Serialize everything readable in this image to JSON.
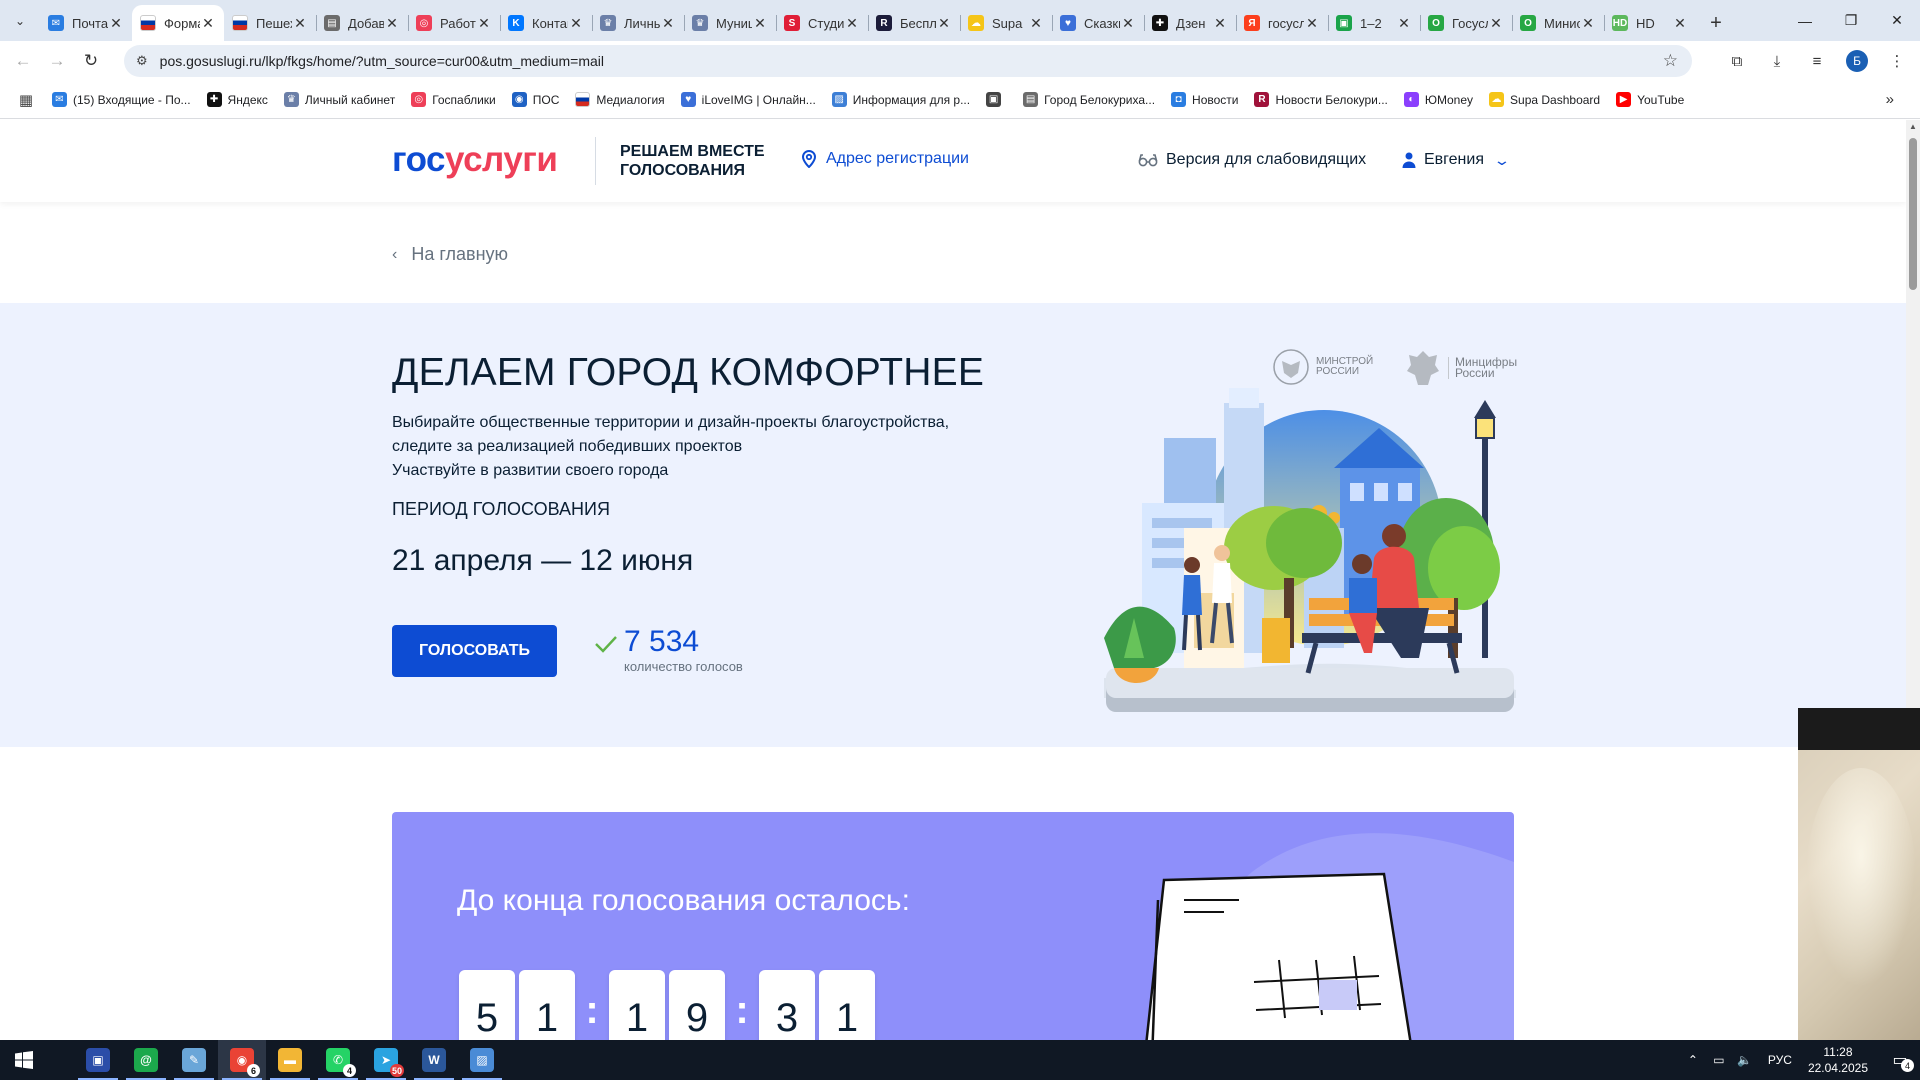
{
  "browser": {
    "tabs": [
      {
        "title": "Почта",
        "favicon": "mail-icon",
        "color": "#2a7de1",
        "glyph": "✉"
      },
      {
        "title": "Форма голосования",
        "favicon": "russia-flag-icon",
        "color": "#d52b1e",
        "glyph": "",
        "active": true
      },
      {
        "title": "Пешеходные",
        "favicon": "russia-flag-icon",
        "color": "#d52b1e",
        "glyph": ""
      },
      {
        "title": "Добавить",
        "favicon": "document-icon",
        "color": "#6b6b6b",
        "glyph": "▤"
      },
      {
        "title": "Работа",
        "favicon": "gosuslugi-icon",
        "color": "#ee3f58",
        "glyph": "◎"
      },
      {
        "title": "Контакт",
        "favicon": "vk-icon",
        "color": "#0077ff",
        "glyph": "K"
      },
      {
        "title": "Личный",
        "favicon": "emblem-icon",
        "color": "#6b7fa8",
        "glyph": "♛"
      },
      {
        "title": "Муниципальные",
        "favicon": "emblem-icon",
        "color": "#6b7fa8",
        "glyph": "♛"
      },
      {
        "title": "Студия",
        "favicon": "s-icon",
        "color": "#e01e37",
        "glyph": "S"
      },
      {
        "title": "Бесплатно",
        "favicon": "r-icon",
        "color": "#1c1c3a",
        "glyph": "R"
      },
      {
        "title": "Supa",
        "favicon": "supa-icon",
        "color": "#f5c518",
        "glyph": "☁"
      },
      {
        "title": "Сказки",
        "favicon": "heart-icon",
        "color": "#3b6fd8",
        "glyph": "♥"
      },
      {
        "title": "Дзен",
        "favicon": "dzen-icon",
        "color": "#111111",
        "glyph": "✚"
      },
      {
        "title": "госуслуги",
        "favicon": "yandex-icon",
        "color": "#fc3f1d",
        "glyph": "Я"
      },
      {
        "title": "1–2",
        "favicon": "green-icon",
        "color": "#1aa34a",
        "glyph": "▣"
      },
      {
        "title": "Госуслуги",
        "favicon": "ok-icon",
        "color": "#27a744",
        "glyph": "O"
      },
      {
        "title": "Министерство",
        "favicon": "ok-icon",
        "color": "#27a744",
        "glyph": "O"
      },
      {
        "title": "HD",
        "favicon": "hd-icon",
        "color": "#5cb85c",
        "glyph": "HD"
      }
    ],
    "new_tab": "+",
    "url": "pos.gosuslugi.ru/lkp/fkgs/home/?utm_source=cur00&utm_medium=mail",
    "profile_letter": "Б",
    "bookmarks": [
      {
        "label": "(15) Входящие - По...",
        "favicon": "mail-icon",
        "color": "#2a7de1",
        "glyph": "✉"
      },
      {
        "label": "Яндекс",
        "favicon": "dzen-icon",
        "color": "#111111",
        "glyph": "✚"
      },
      {
        "label": "Личный кабинет",
        "favicon": "emblem-icon",
        "color": "#6b7fa8",
        "glyph": "♛"
      },
      {
        "label": "Госпаблики",
        "favicon": "gosuslugi-icon",
        "color": "#ee3f58",
        "glyph": "◎"
      },
      {
        "label": "ПОС",
        "favicon": "pos-icon",
        "color": "#1f62c4",
        "glyph": "◉"
      },
      {
        "label": "Медиалогия",
        "favicon": "russia-flag-icon",
        "color": "#d52b1e",
        "glyph": ""
      },
      {
        "label": "iLoveIMG | Онлайн...",
        "favicon": "heart-icon",
        "color": "#3b6fd8",
        "glyph": "♥"
      },
      {
        "label": "Информация для р...",
        "favicon": "image-icon",
        "color": "#3d7fd6",
        "glyph": "▨"
      },
      {
        "label": "",
        "favicon": "monitor-icon",
        "color": "#444444",
        "glyph": "▣"
      },
      {
        "label": "Город Белокуриха...",
        "favicon": "document-icon",
        "color": "#6b6b6b",
        "glyph": "▤"
      },
      {
        "label": "Новости",
        "favicon": "chat-icon",
        "color": "#2a7de1",
        "glyph": "◘"
      },
      {
        "label": "Новости Белокури...",
        "favicon": "r-icon",
        "color": "#a0123a",
        "glyph": "R"
      },
      {
        "label": "ЮMoney",
        "favicon": "yoomoney-icon",
        "color": "#8b3ffd",
        "glyph": "◐"
      },
      {
        "label": "Supa Dashboard",
        "favicon": "supa-icon",
        "color": "#f5c518",
        "glyph": "☁"
      },
      {
        "label": "YouTube",
        "favicon": "youtube-icon",
        "color": "#ff0000",
        "glyph": "▶"
      }
    ]
  },
  "site": {
    "logo_part1": "гос",
    "logo_part2": "услуги",
    "project_line1": "РЕШАЕМ ВМЕСТЕ",
    "project_line2": "ГОЛОСОВАНИЯ",
    "address_link": "Адрес регистрации",
    "accessibility": "Версия для слабовидящих",
    "user_name": "Евгения",
    "back_link": "На главную"
  },
  "hero": {
    "title": "ДЕЛАЕМ ГОРОД КОМФОРТНЕЕ",
    "desc_line1": "Выбирайте общественные территории и дизайн-проекты благоустройства,",
    "desc_line2": "следите за реализацией победивших проектов",
    "desc_line3": "Участвуйте в развитии своего города",
    "period_label": "ПЕРИОД ГОЛОСОВАНИЯ",
    "period": "21 апреля — 12 июня",
    "vote_button": "ГОЛОСОВАТЬ",
    "votes_count": "7 534",
    "votes_label": "количество голосов",
    "ministry1_line1": "МИНСТРОЙ",
    "ministry1_line2": "РОССИИ",
    "ministry2_line1": "Минцифры",
    "ministry2_line2": "России"
  },
  "countdown": {
    "title": "До конца голосования осталось:",
    "digits": [
      "5",
      "1",
      "1",
      "9",
      "3",
      "1"
    ],
    "separator": ":"
  },
  "taskbar": {
    "apps": [
      {
        "name": "save-app",
        "color": "#2b4da8",
        "glyph": "▣"
      },
      {
        "name": "mail-ru-agent-app",
        "color": "#1ca84c",
        "glyph": "@"
      },
      {
        "name": "notepad-app",
        "color": "#6aa6d8",
        "glyph": "✎"
      },
      {
        "name": "chrome-app",
        "color": "#ea4335",
        "glyph": "◉",
        "badge": "6",
        "active": true
      },
      {
        "name": "explorer-app",
        "color": "#f2b635",
        "glyph": "▬"
      },
      {
        "name": "whatsapp-app",
        "color": "#25d366",
        "glyph": "✆",
        "badge": "4"
      },
      {
        "name": "telegram-app",
        "color": "#2aa3e0",
        "glyph": "➤",
        "badge": "50",
        "badge_red": true
      },
      {
        "name": "word-app",
        "color": "#2b579a",
        "glyph": "W"
      },
      {
        "name": "photos-app",
        "color": "#4a8bd6",
        "glyph": "▨"
      }
    ],
    "lang": "РУС",
    "time": "11:28",
    "date": "22.04.2025",
    "notifications": "4"
  }
}
